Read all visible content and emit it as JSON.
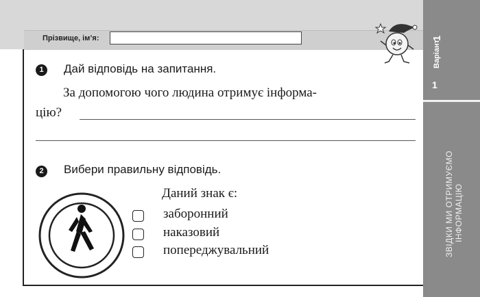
{
  "header": {
    "name_label": "Прізвище, ім’я:",
    "name_value": ""
  },
  "sidebar": {
    "variant_label": "Варіант",
    "variant_number": "1",
    "topic": [
      "ЗВІДКИ МИ ОТРИМУЄМО",
      "ІНФОРМАЦІЮ"
    ],
    "background_color": "#8a8a8a"
  },
  "task1": {
    "number": "1",
    "title": "Дай відповідь на запитання.",
    "question_line1": "За допомогою чого людина отримує інформа-",
    "question_line2": "цію?"
  },
  "task2": {
    "number": "2",
    "title": "Вибери правильну відповідь.",
    "caption": "Даний знак є:",
    "options": [
      "заборонний",
      "наказовий",
      "попереджувальний"
    ],
    "sign_icon": "pedestrian-sign-icon"
  }
}
